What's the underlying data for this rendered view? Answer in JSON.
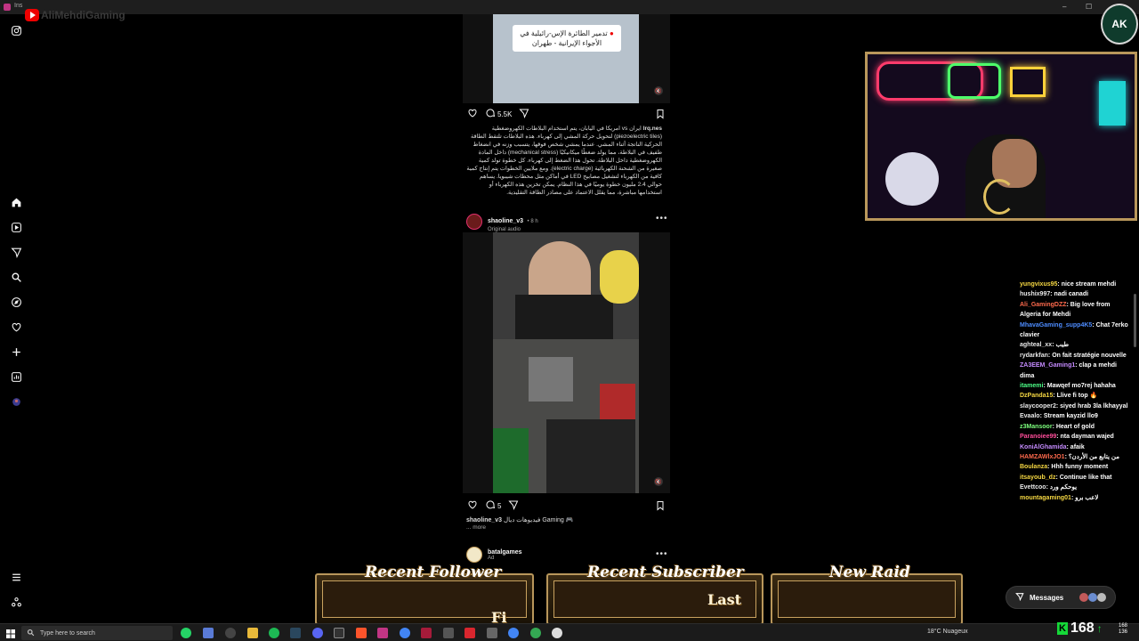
{
  "browser": {
    "tab_title": "Ins",
    "controls": [
      "–",
      "☐",
      "✕"
    ]
  },
  "overlay": {
    "youtube_channel": "AliMehdiGaming",
    "logo_text": "AK"
  },
  "left_nav": {
    "items": [
      "home",
      "reels",
      "messages",
      "search",
      "explore",
      "notifications",
      "create",
      "dashboard",
      "profile"
    ],
    "bottom": [
      "menu",
      "also-from-meta"
    ]
  },
  "feed": {
    "post1": {
      "image_caption": "تدمير الطائرة الإس-رائيلية في الأجواء الإيرانية - طهران",
      "comments": "5.5K",
      "caption_user": "lrq.nes",
      "caption_text": "ايران vs امريكا في اليابان، يتم استخدام البلاطات الكهروضغطية (piezoelectric tiles) لتحويل حركة المشي إلى كهرباء. هذه البلاطات تلتقط الطاقة الحركية الناتجة أثناء المشي. عندما يمشي شخص فوقها، يتسبب وزنه في انضغاط طفيف في البلاطة، مما يولد ضغطًا ميكانيكيًا (mechanical stress) داخل المادة الكهروضغطية داخل البلاطة. تحول هذا الضغط إلى كهرباء. كل خطوة تولد كمية صغيرة من الشحنة الكهربائية (electric charge). ومع ملايين الخطوات يتم إنتاج كمية كافية من الكهرباء لتشغيل مصابيح LED في أماكن مثل محطات شيبويا. يساهم حوالي 2.4 مليون خطوة يوميًا في هذا النظام. يمكن تخزين هذه الكهرباء أو استخدامها مباشرة، مما يقلل الاعتماد على مصادر الطاقة التقليدية."
    },
    "post2": {
      "username": "shaoline_v3",
      "time": "8 h",
      "audio": "Original audio",
      "comments": "5",
      "caption_user": "shaoline_v3",
      "caption_text": "فيديوهات ديال Gaming 🎮",
      "more": "... more"
    },
    "post3": {
      "username": "batalgames",
      "label": "Ad"
    }
  },
  "chat": {
    "messages": [
      {
        "user": "yungvixus95",
        "color": "#f5d742",
        "text": "nice stream mehdi"
      },
      {
        "user": "hushix997",
        "color": "#e8e8e8",
        "text": "nadi canadi"
      },
      {
        "user": "Ali_GamingDZZ",
        "color": "#ff6a4d",
        "text": "Big love from Algeria for Mehdi"
      },
      {
        "user": "MhavaGaming_supp4K5",
        "color": "#4d8cff",
        "text": "Chat 7erko clavier"
      },
      {
        "user": "aghteal_xx",
        "color": "#e8e8e8",
        "text": "طيب"
      },
      {
        "user": "rydarkfan",
        "color": "#e8e8e8",
        "text": "On fait stratégie nouvelle"
      },
      {
        "user": "ZA3EEM_Gaming1",
        "color": "#c58bff",
        "text": "clap a mehdi dima"
      },
      {
        "user": "itamemi",
        "color": "#4dff88",
        "text": "Mawqef mo7rej hahaha"
      },
      {
        "user": "DzPanda15",
        "color": "#f5d742",
        "text": "Llive fi top 🔥"
      },
      {
        "user": "slaycooper2",
        "color": "#e8e8e8",
        "text": "siyed hrab 3la lkhayyal"
      },
      {
        "user": "Evaalo",
        "color": "#e8e8e8",
        "text": "Stream kayzid llo9"
      },
      {
        "user": "z3Mansoor",
        "color": "#7dff7d",
        "text": "Heart of gold"
      },
      {
        "user": "Paranoiee99",
        "color": "#ff4d9a",
        "text": "nta dayman wajed"
      },
      {
        "user": "KoniAlGhamida",
        "color": "#c58bff",
        "text": "afaik"
      },
      {
        "user": "HAMZAWlxJO1",
        "color": "#ff6a4d",
        "text": "من يتابع من الأردن؟"
      },
      {
        "user": "Boulanza",
        "color": "#f5d742",
        "text": "Hhh funny moment"
      },
      {
        "user": "itsayoub_dz",
        "color": "#f5d742",
        "text": "Continue like that"
      },
      {
        "user": "Evettcoo",
        "color": "#e8e8e8",
        "text": "يوحكم ورد"
      },
      {
        "user": "mountagaming01",
        "color": "#f5d742",
        "text": "لاعب برو"
      }
    ]
  },
  "alerts": {
    "follower": {
      "title": "Recent Follower",
      "value": "Fi"
    },
    "subscriber": {
      "title": "Recent Subscriber",
      "value": "Last"
    },
    "raid": {
      "title": "New Raid",
      "value": ""
    }
  },
  "messages_pill": {
    "label": "Messages"
  },
  "taskbar": {
    "search_placeholder": "Type here to search",
    "weather": "18°C Nuageux",
    "viewers": "168",
    "mini_top": "168",
    "mini_bottom": "136"
  },
  "colors": {
    "accent_gold": "#b9975b",
    "kick_green": "#15d838",
    "ig_pink": "#e1306c"
  }
}
